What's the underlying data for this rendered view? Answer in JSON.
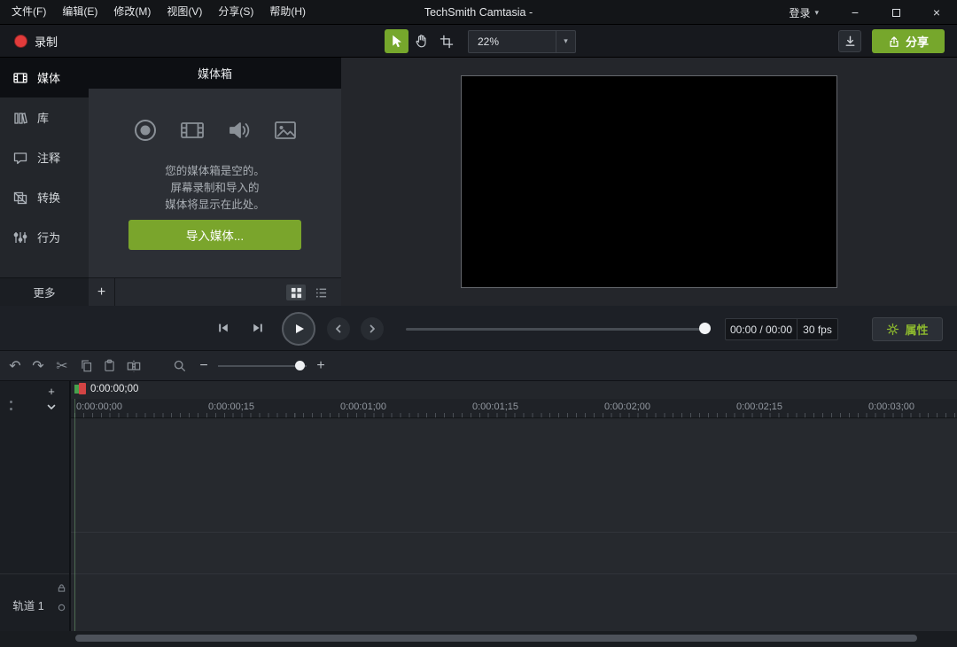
{
  "icons": {
    "caret_down": "▾",
    "minimize": "−",
    "close": "×",
    "plus": "+",
    "minus": "−",
    "undo": "↶",
    "redo": "↷",
    "scissors": "✂"
  },
  "titlebar": {
    "title": "TechSmith Camtasia -",
    "menus": [
      {
        "label": "文件(F)"
      },
      {
        "label": "编辑(E)"
      },
      {
        "label": "修改(M)"
      },
      {
        "label": "视图(V)"
      },
      {
        "label": "分享(S)"
      },
      {
        "label": "帮助(H)"
      }
    ],
    "signin_label": "登录"
  },
  "toolbar": {
    "record_label": "录制",
    "zoom_value": "22%",
    "share_label": "分享"
  },
  "sidebar": {
    "items": [
      {
        "label": "媒体"
      },
      {
        "label": "库"
      },
      {
        "label": "注释"
      },
      {
        "label": "转换"
      },
      {
        "label": "行为"
      }
    ],
    "more_label": "更多"
  },
  "media_bin": {
    "header": "媒体箱",
    "empty_line1": "您的媒体箱是空的。",
    "empty_line2": "屏幕录制和导入的",
    "empty_line3": "媒体将显示在此处。",
    "import_label": "导入媒体..."
  },
  "playback": {
    "time_display": "00:00 / 00:00",
    "fps": "30 fps",
    "properties_label": "属性"
  },
  "timeline": {
    "playhead_time": "0:00:00;00",
    "ruler_ticks": [
      "0:00:00;00",
      "0:00:00;15",
      "0:00:01;00",
      "0:00:01;15",
      "0:00:02;00",
      "0:00:02;15",
      "0:00:03;00"
    ],
    "track1_label": "轨道 1"
  },
  "colors": {
    "accent_green": "#76a72c",
    "record_red": "#e23b3b",
    "playhead_red": "#d24444",
    "playhead_green": "#47a04d"
  }
}
